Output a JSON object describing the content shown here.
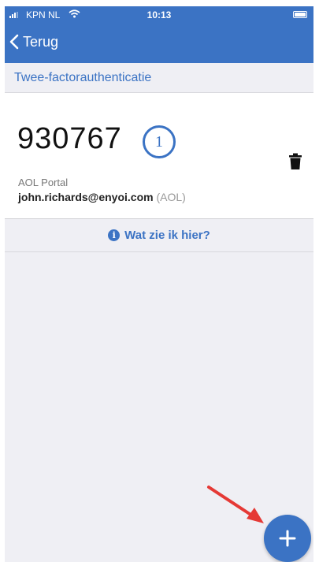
{
  "status_bar": {
    "carrier": "KPN NL",
    "time": "10:13"
  },
  "nav": {
    "back_label": "Terug"
  },
  "section": {
    "title": "Twee-factorauthenticatie"
  },
  "account": {
    "code": "930767",
    "timer_seconds": "1",
    "name": "AOL Portal",
    "email": "john.richards@enyoi.com",
    "provider": "(AOL)"
  },
  "help": {
    "label": "Wat zie ik hier?"
  },
  "icons": {
    "back": "chevron-left-icon",
    "timer": "countdown-ring-icon",
    "delete": "trash-icon",
    "info": "info-icon",
    "add": "plus-icon",
    "wifi": "wifi-icon",
    "battery": "battery-icon",
    "annotation": "red-arrow-icon"
  },
  "colors": {
    "brand": "#3b73c4",
    "background": "#efeff4",
    "annotation": "#e53935"
  }
}
